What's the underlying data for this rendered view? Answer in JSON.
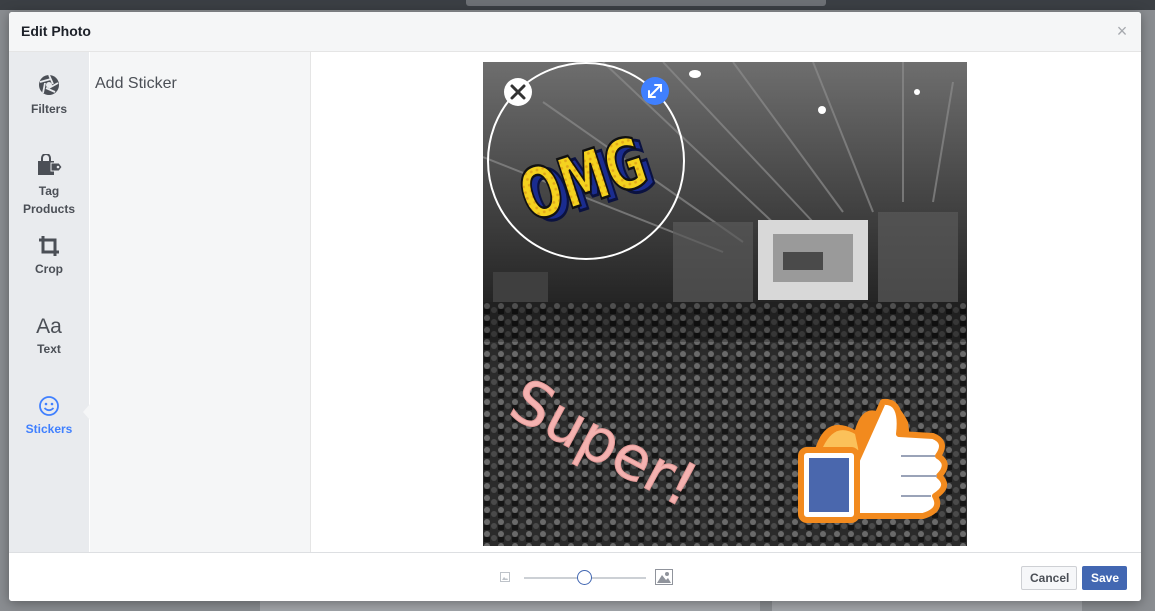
{
  "dialog": {
    "title": "Edit Photo",
    "close_icon": "close-icon"
  },
  "tools": [
    {
      "label": "Filters",
      "icon": "aperture-icon"
    },
    {
      "label": "Tag\nProducts",
      "icon": "shopping-bag-icon"
    },
    {
      "label": "Crop",
      "icon": "crop-icon"
    },
    {
      "label": "Text",
      "icon": "text-aa-icon",
      "glyph": "Aa"
    },
    {
      "label": "Stickers",
      "icon": "smiley-icon",
      "active": true
    }
  ],
  "panel": {
    "text": "Add Sticker"
  },
  "photo": {
    "stickers": [
      {
        "name": "omg-sticker",
        "text": "OMG",
        "selected": true
      },
      {
        "name": "super-sticker",
        "text": "Super!"
      },
      {
        "name": "thumbs-up-sticker"
      }
    ]
  },
  "footer": {
    "zoom_level": 0.5,
    "cancel_label": "Cancel",
    "save_label": "Save"
  },
  "colors": {
    "accent": "#4080ff",
    "save_button": "#4267b2",
    "super_text": "#f4b2b0"
  }
}
